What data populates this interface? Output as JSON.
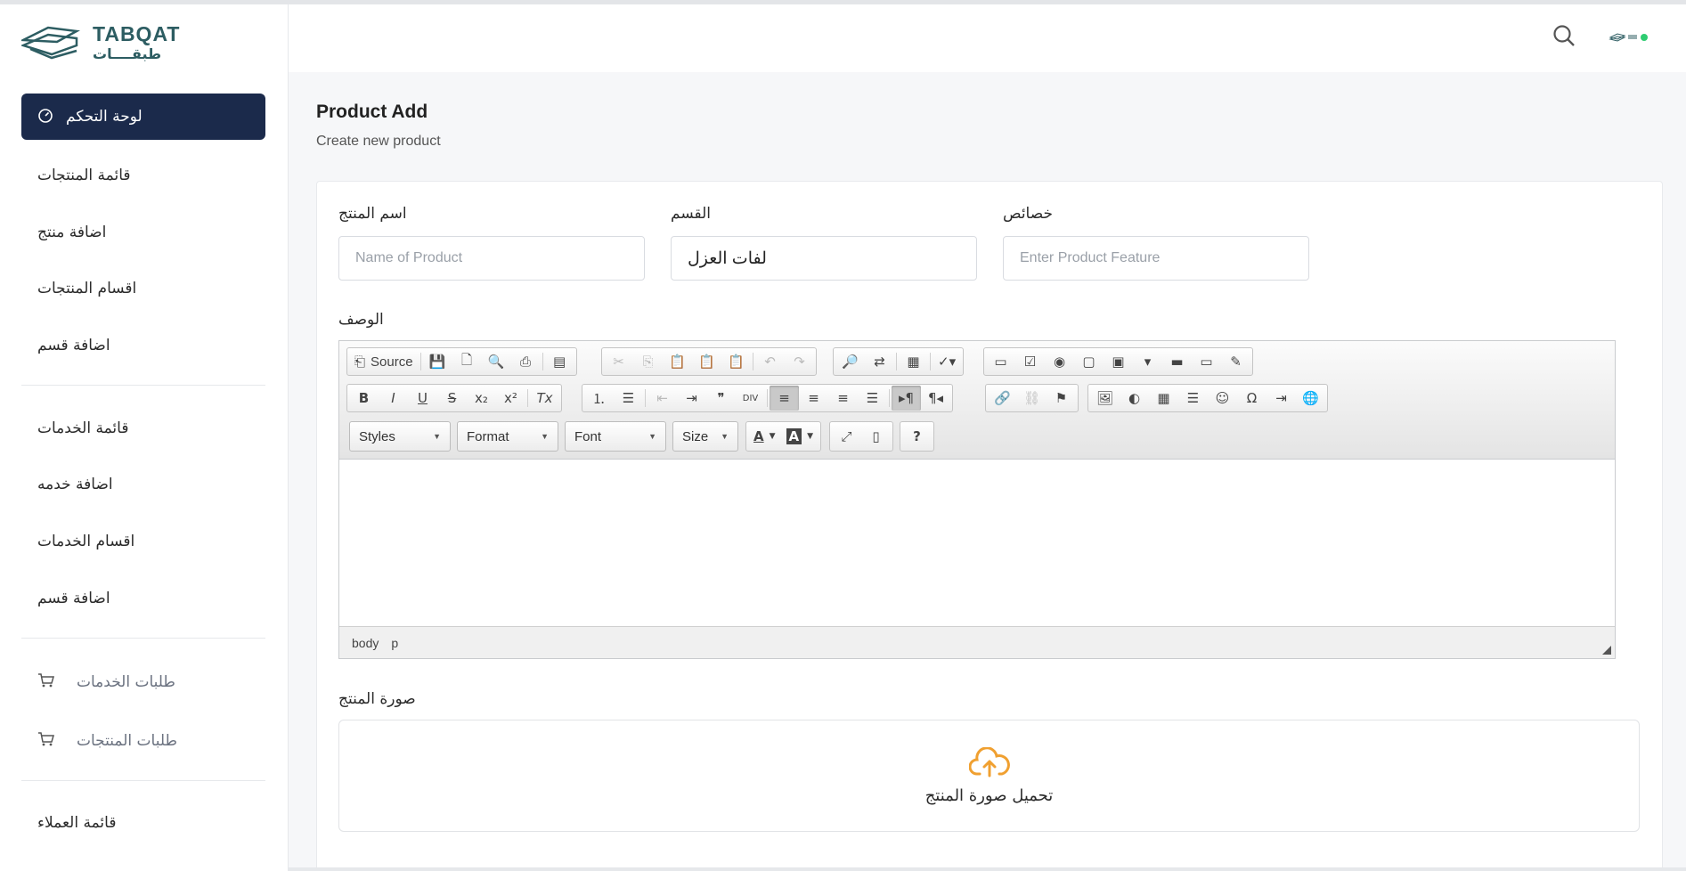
{
  "brand": {
    "name_en": "TABQAT",
    "name_ar": "طبقــــات"
  },
  "sidebar": {
    "items": [
      {
        "label": "لوحة التحكم",
        "icon": "dashboard-gauge-icon",
        "active": true
      },
      {
        "label": "قائمة المنتجات"
      },
      {
        "label": "اضافة منتج"
      },
      {
        "label": "اقسام المنتجات"
      },
      {
        "label": "اضافة قسم"
      },
      {
        "label": "قائمة الخدمات"
      },
      {
        "label": "اضافة خدمه"
      },
      {
        "label": "اقسام الخدمات"
      },
      {
        "label": "اضافة قسم"
      },
      {
        "label": "طلبات الخدمات",
        "icon": "cart-icon"
      },
      {
        "label": "طلبات المنتجات",
        "icon": "cart-icon"
      },
      {
        "label": "قائمة العملاء"
      }
    ]
  },
  "header": {
    "search_icon": "search-icon"
  },
  "page": {
    "title": "Product Add",
    "subtitle": "Create new product"
  },
  "form": {
    "name": {
      "label": "اسم المنتج",
      "placeholder": "Name of Product",
      "value": ""
    },
    "category": {
      "label": "القسم",
      "value": "لفات العزل"
    },
    "features": {
      "label": "خصائص",
      "placeholder": "Enter Product Feature",
      "value": ""
    },
    "description": {
      "label": "الوصف"
    },
    "image": {
      "label": "صورة المنتج",
      "upload_text": "تحميل صورة المنتج"
    }
  },
  "editor": {
    "source_label": "Source",
    "styles_label": "Styles",
    "format_label": "Format",
    "font_label": "Font",
    "size_label": "Size",
    "path": [
      "body",
      "p"
    ]
  },
  "colors": {
    "sidebar_active": "#1b2a4b",
    "upload_accent": "#f0a030",
    "brand": "#2d5d62"
  }
}
